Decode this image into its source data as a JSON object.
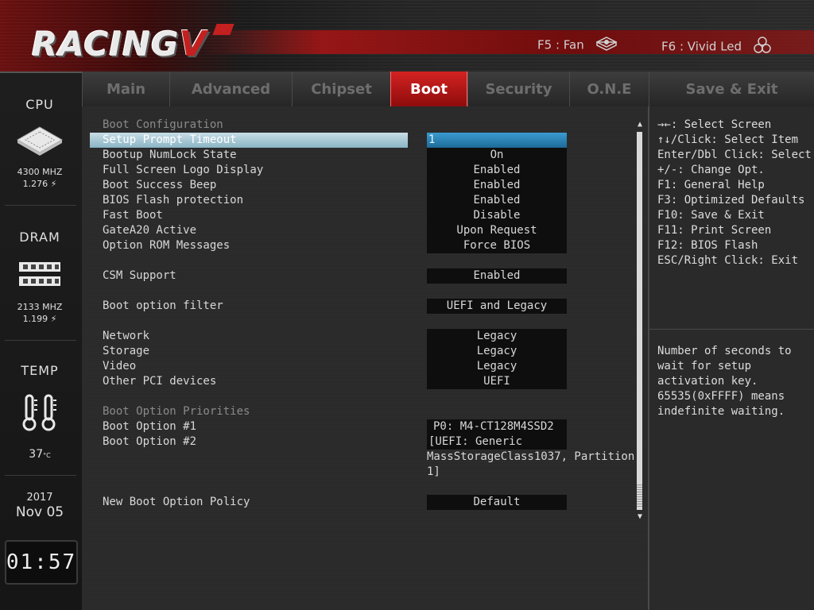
{
  "header": {
    "logo_text": "RACING",
    "logo_suffix": "V",
    "f5_label": "F5 : Fan",
    "f6_label": "F6 : Vivid Led",
    "f5_icon": "fan-icon",
    "f6_icon": "led-icon"
  },
  "sidebar": {
    "cpu": {
      "title": "CPU",
      "freq": "4300 MHZ",
      "volt": "1.276",
      "icon": "cpu-chip-icon"
    },
    "dram": {
      "title": "DRAM",
      "freq": "2133 MHZ",
      "volt": "1.199",
      "icon": "ram-module-icon"
    },
    "temp": {
      "title": "TEMP",
      "value": "37",
      "unit": "°C",
      "icon": "thermometer-icon"
    },
    "date": {
      "year": "2017",
      "day": "Nov 05"
    },
    "time": "01:57"
  },
  "tabs": [
    {
      "label": "Main",
      "active": false
    },
    {
      "label": "Advanced",
      "active": false
    },
    {
      "label": "Chipset",
      "active": false
    },
    {
      "label": "Boot",
      "active": true
    },
    {
      "label": "Security",
      "active": false
    },
    {
      "label": "O.N.E",
      "active": false
    },
    {
      "label": "Save & Exit",
      "active": false
    }
  ],
  "settings": {
    "section_boot_config": "Boot Configuration",
    "setup_prompt_timeout": {
      "label": "Setup Prompt Timeout",
      "value": "1"
    },
    "numlock": {
      "label": "Bootup NumLock State",
      "value": "On"
    },
    "fullscreen_logo": {
      "label": "Full Screen Logo Display",
      "value": "Enabled"
    },
    "success_beep": {
      "label": "Boot Success Beep",
      "value": "Enabled"
    },
    "bios_flash": {
      "label": "BIOS Flash protection",
      "value": "Enabled"
    },
    "fast_boot": {
      "label": "Fast Boot",
      "value": "Disable"
    },
    "gatea20": {
      "label": "GateA20 Active",
      "value": "Upon Request"
    },
    "option_rom": {
      "label": "Option ROM Messages",
      "value": "Force BIOS"
    },
    "csm": {
      "label": "CSM Support",
      "value": "Enabled"
    },
    "boot_filter": {
      "label": "Boot option filter",
      "value": "UEFI and Legacy"
    },
    "network": {
      "label": "Network",
      "value": "Legacy"
    },
    "storage": {
      "label": "Storage",
      "value": "Legacy"
    },
    "video": {
      "label": "Video",
      "value": "Legacy"
    },
    "other_pci": {
      "label": "Other PCI devices",
      "value": "UEFI"
    },
    "section_priorities": "Boot Option Priorities",
    "boot_opt1": {
      "label": "Boot Option #1",
      "value": "P0: M4-CT128M4SSD2"
    },
    "boot_opt2": {
      "label": "Boot Option #2",
      "value_line1": "[UEFI: Generic",
      "value_line2": "MassStorageClass1037, Partition",
      "value_line3": "1]"
    },
    "new_boot_policy": {
      "label": "New Boot Option Policy",
      "value": "Default"
    }
  },
  "help": {
    "keys": [
      "→←: Select Screen",
      "↑↓/Click: Select Item",
      "Enter/Dbl Click: Select",
      "+/-: Change Opt.",
      "F1: General Help",
      "F3: Optimized Defaults",
      "F10: Save & Exit",
      "F11: Print Screen",
      "F12: BIOS Flash",
      "ESC/Right Click: Exit"
    ],
    "description": [
      "Number of seconds to",
      "wait for setup",
      "activation key.",
      "65535(0xFFFF) means",
      "indefinite waiting."
    ]
  },
  "colors": {
    "accent_red": "#c42020",
    "selection_blue": "#2a86bb",
    "selection_row": "#a9c9d6"
  }
}
